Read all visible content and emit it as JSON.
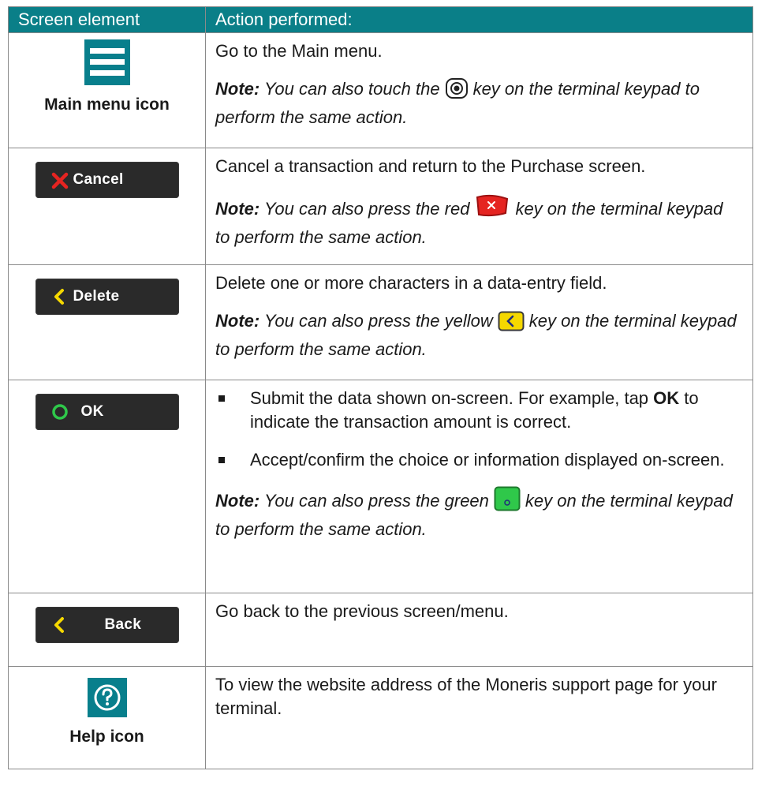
{
  "table": {
    "header": {
      "col1": "Screen element",
      "col2": "Action performed:"
    },
    "rows": [
      {
        "element_label": "Main menu icon",
        "element_icon": "hamburger-menu-icon",
        "action": "Go to the Main menu.",
        "note_label": "Note:",
        "note_pre": "You can also touch the",
        "note_key_icon": "circle-dot-key-icon",
        "note_post": "key on the terminal keypad to perform the same action."
      },
      {
        "button_label": "Cancel",
        "button_icon": "red-x-icon",
        "action": "Cancel a transaction and return to the Purchase screen.",
        "note_label": "Note:",
        "note_pre": "You can also press the red",
        "note_key_icon": "red-cancel-key-icon",
        "note_post": "key on the terminal keypad to perform the same action."
      },
      {
        "button_label": "Delete",
        "button_icon": "yellow-chevron-left-icon",
        "action": "Delete one or more characters in a data-entry field.",
        "note_label": "Note:",
        "note_pre": "You can also press the yellow",
        "note_key_icon": "yellow-delete-key-icon",
        "note_post": "key on the terminal keypad to perform the same action."
      },
      {
        "button_label": "OK",
        "button_icon": "green-circle-icon",
        "bullet1_pre": "Submit the data shown on-screen. For example, tap",
        "bullet1_bold": "OK",
        "bullet1_post": "to indicate the transaction amount is correct.",
        "bullet2": "Accept/confirm the choice or information displayed on-screen.",
        "note_label": "Note:",
        "note_pre": "You can also press the green",
        "note_key_icon": "green-ok-key-icon",
        "note_post": "key on the terminal keypad to perform the same action."
      },
      {
        "button_label": "Back",
        "button_icon": "yellow-chevron-left-icon",
        "action": "Go back to the previous screen/menu."
      },
      {
        "element_label": "Help icon",
        "element_icon": "question-mark-icon",
        "action": "To view the website address of the Moneris support page for your terminal."
      }
    ]
  },
  "colors": {
    "header_bg": "#0a7f88",
    "icon_tile": "#087f8c",
    "button_bg": "#2a2a2a",
    "red": "#e52421",
    "yellow": "#f5d800",
    "green": "#2fc84a"
  }
}
